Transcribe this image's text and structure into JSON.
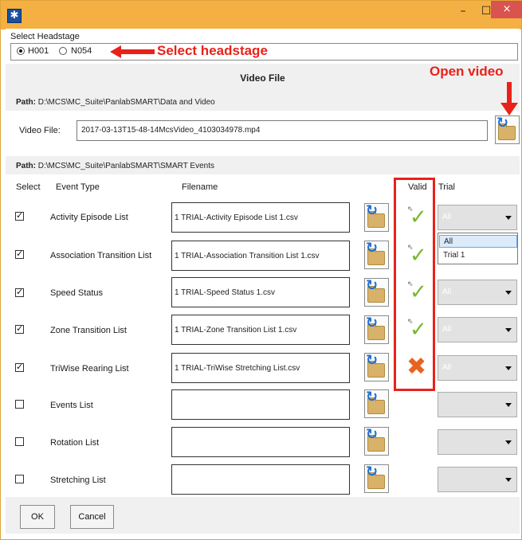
{
  "window": {
    "close_glyph": "×",
    "minimize_glyph": "–",
    "maximize_glyph": "☐"
  },
  "headstage": {
    "group_label": "Select Headstage",
    "options": [
      {
        "label": "H001",
        "selected": true
      },
      {
        "label": "N054",
        "selected": false
      }
    ]
  },
  "annotations": {
    "select_headstage": "Select headstage",
    "open_video": "Open video"
  },
  "video": {
    "title": "Video File",
    "path_label": "Path:",
    "path_value": "D:\\MCS\\MC_Suite\\PanlabSMART\\Data and Video",
    "field_label": "Video File:",
    "field_value": "2017-03-13T15-48-14McsVideo_4103034978.mp4"
  },
  "events": {
    "path_label": "Path:",
    "path_value": "D:\\MCS\\MC_Suite\\PanlabSMART\\SMART Events",
    "columns": {
      "select": "Select",
      "event_type": "Event Type",
      "filename": "Filename",
      "valid": "Valid",
      "trial": "Trial"
    },
    "rows": [
      {
        "checked": true,
        "type": "Activity Episode List",
        "filename": "1 TRIAL-Activity Episode List 1.csv",
        "valid": "ok",
        "trial": "All"
      },
      {
        "checked": true,
        "type": "Association Transition List",
        "filename": "1 TRIAL-Association Transition List 1.csv",
        "valid": "",
        "trial": ""
      },
      {
        "checked": true,
        "type": "Speed Status",
        "filename": "1 TRIAL-Speed Status 1.csv",
        "valid": "ok",
        "trial": "All"
      },
      {
        "checked": true,
        "type": "Zone Transition List",
        "filename": "1 TRIAL-Zone Transition List 1.csv",
        "valid": "ok",
        "trial": "All"
      },
      {
        "checked": true,
        "type": "TriWise Rearing List",
        "filename": "1 TRIAL-TriWise Stretching List.csv",
        "valid": "bad",
        "trial": "All"
      },
      {
        "checked": false,
        "type": "Events List",
        "filename": "",
        "valid": "",
        "trial": ""
      },
      {
        "checked": false,
        "type": "Rotation List",
        "filename": "",
        "valid": "",
        "trial": ""
      },
      {
        "checked": false,
        "type": "Stretching List",
        "filename": "",
        "valid": "",
        "trial": ""
      }
    ],
    "trial_dropdown_options": [
      "All",
      "Trial 1"
    ]
  },
  "buttons": {
    "ok": "OK",
    "cancel": "Cancel"
  },
  "icons": {
    "app": "app-icon",
    "folder_open": "folder-open-icon",
    "valid_ok": "green-check-icon",
    "valid_bad": "orange-x-icon",
    "caret": "chevron-down-icon",
    "cursor": "mouse-cursor-icon"
  },
  "colors": {
    "titlebar": "#f4b042",
    "annotation": "#e8221a",
    "check": "#77b82c",
    "cross": "#e8631f",
    "close": "#d9534f"
  }
}
